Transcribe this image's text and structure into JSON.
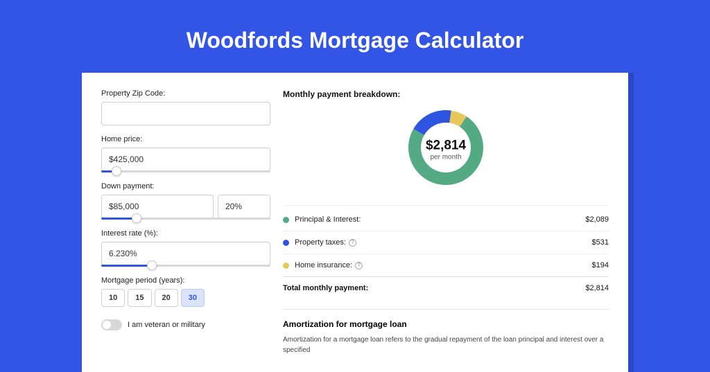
{
  "title": "Woodfords Mortgage Calculator",
  "form": {
    "zip_label": "Property Zip Code:",
    "zip_value": "",
    "home_price_label": "Home price:",
    "home_price_value": "$425,000",
    "home_price_slider_pct": 9,
    "down_label": "Down payment:",
    "down_value": "$85,000",
    "down_pct_value": "20%",
    "down_slider_pct": 21,
    "rate_label": "Interest rate (%):",
    "rate_value": "6.230%",
    "rate_slider_pct": 30,
    "period_label": "Mortgage period (years):",
    "periods": [
      "10",
      "15",
      "20",
      "30"
    ],
    "period_selected_index": 3,
    "veteran_label": "I am veteran or military",
    "veteran_on": false
  },
  "breakdown": {
    "section_title": "Monthly payment breakdown:",
    "donut": {
      "value": "$2,814",
      "sub": "per month",
      "seg_green_pct": 74,
      "seg_blue_pct": 19,
      "seg_yellow_pct": 7
    },
    "rows": [
      {
        "color": "green",
        "label": "Principal & Interest:",
        "value": "$2,089",
        "info": false
      },
      {
        "color": "blue",
        "label": "Property taxes:",
        "value": "$531",
        "info": true
      },
      {
        "color": "yellow",
        "label": "Home insurance:",
        "value": "$194",
        "info": true
      }
    ],
    "total_label": "Total monthly payment:",
    "total_value": "$2,814"
  },
  "amort": {
    "title": "Amortization for mortgage loan",
    "text": "Amortization for a mortgage loan refers to the gradual repayment of the loan principal and interest over a specified"
  },
  "chart_data": {
    "type": "pie",
    "title": "Monthly payment breakdown",
    "categories": [
      "Principal & Interest",
      "Property taxes",
      "Home insurance"
    ],
    "values": [
      2089,
      531,
      194
    ],
    "total": 2814,
    "colors": [
      "#54ab83",
      "#2f55e0",
      "#e8c85a"
    ]
  }
}
